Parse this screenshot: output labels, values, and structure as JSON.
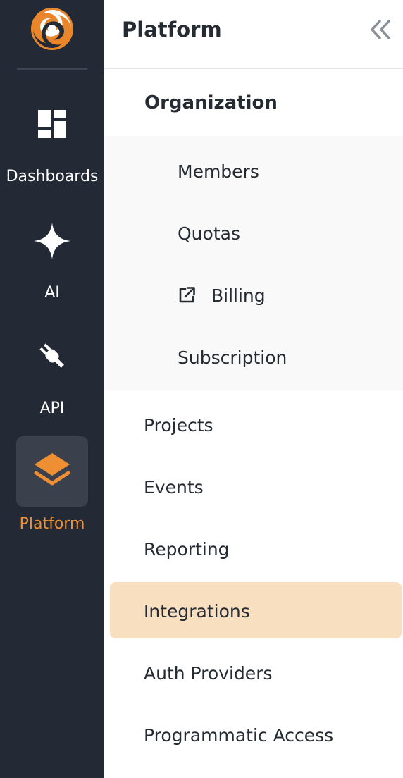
{
  "rail": {
    "items": [
      {
        "label": "Dashboards",
        "icon": "dashboard-grid-icon"
      },
      {
        "label": "AI",
        "icon": "sparkle-icon"
      },
      {
        "label": "API",
        "icon": "plug-icon"
      },
      {
        "label": "Platform",
        "icon": "layers-icon",
        "active": true
      }
    ]
  },
  "panel": {
    "title": "Platform",
    "collapse_icon": "double-chevron-left-icon",
    "group": {
      "title": "Organization",
      "items": [
        {
          "label": "Members"
        },
        {
          "label": "Quotas"
        },
        {
          "label": "Billing",
          "icon": "external-link-icon"
        },
        {
          "label": "Subscription"
        }
      ]
    },
    "items": [
      {
        "label": "Projects"
      },
      {
        "label": "Events"
      },
      {
        "label": "Reporting"
      },
      {
        "label": "Integrations",
        "selected": true
      },
      {
        "label": "Auth Providers"
      },
      {
        "label": "Programmatic Access"
      }
    ]
  },
  "colors": {
    "rail_bg": "#232a35",
    "accent": "#ee8f33",
    "selected_bg": "#f7dfc0",
    "submenu_bg": "#f9f9f9",
    "text": "#252b33"
  }
}
